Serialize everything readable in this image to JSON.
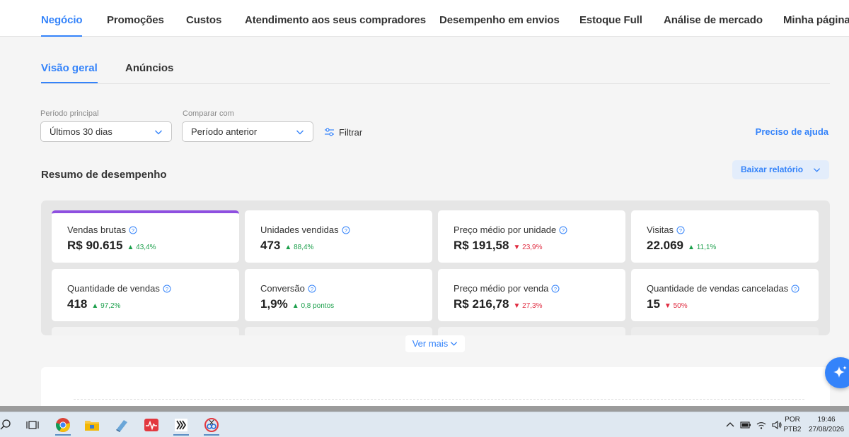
{
  "top_nav": {
    "tabs": [
      {
        "label": "Negócio",
        "active": true
      },
      {
        "label": "Promoções"
      },
      {
        "label": "Custos"
      },
      {
        "label": "Atendimento aos seus compradores"
      },
      {
        "label": "Desempenho em envios"
      },
      {
        "label": "Estoque Full"
      },
      {
        "label": "Análise de mercado"
      },
      {
        "label": "Minha página"
      }
    ]
  },
  "sub_tabs": [
    {
      "label": "Visão geral",
      "active": true
    },
    {
      "label": "Anúncios"
    }
  ],
  "filters": {
    "main_period_label": "Período principal",
    "main_period_value": "Últimos 30 dias",
    "compare_label": "Comparar com",
    "compare_value": "Período anterior",
    "filter_label": "Filtrar",
    "help_link": "Preciso de ajuda"
  },
  "summary": {
    "title": "Resumo de desempenho",
    "download_label": "Baixar relatório",
    "see_more": "Ver mais"
  },
  "metrics": [
    {
      "title": "Vendas brutas",
      "value": "R$ 90.615",
      "delta": "43,4%",
      "direction": "up",
      "selected": true
    },
    {
      "title": "Unidades vendidas",
      "value": "473",
      "delta": "88,4%",
      "direction": "up"
    },
    {
      "title": "Preço médio por unidade",
      "value": "R$ 191,58",
      "delta": "23,9%",
      "direction": "down"
    },
    {
      "title": "Visitas",
      "value": "22.069",
      "delta": "11,1%",
      "direction": "up"
    },
    {
      "title": "Quantidade de vendas",
      "value": "418",
      "delta": "97,2%",
      "direction": "up"
    },
    {
      "title": "Conversão",
      "value": "1,9%",
      "delta": "0,8 pontos",
      "direction": "up"
    },
    {
      "title": "Preço médio por venda",
      "value": "R$ 216,78",
      "delta": "27,3%",
      "direction": "down"
    },
    {
      "title": "Quantidade de vendas canceladas",
      "value": "15",
      "delta": "50%",
      "direction": "down"
    }
  ],
  "colors": {
    "accent": "#3483fa",
    "selected_card": "#8e4fe0",
    "positive": "#1a9f4a",
    "negative": "#e02a3f"
  },
  "taskbar": {
    "icons": [
      "search-icon",
      "task-view-icon",
      "chrome-icon",
      "file-explorer-icon",
      "app-icon",
      "pulse-app-icon",
      "zebra-app-icon",
      "snip-app-icon"
    ],
    "language_line1": "POR",
    "language_line2": "PTB2",
    "time": "19:46",
    "date": "27/08/2026"
  }
}
